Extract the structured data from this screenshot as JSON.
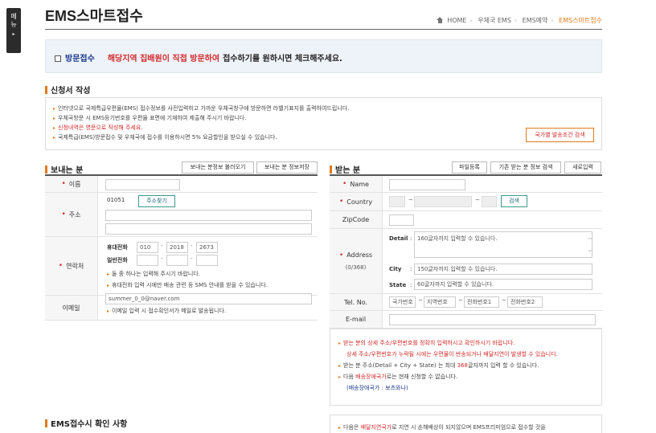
{
  "side_menu": {
    "label_1": "메",
    "label_2": "뉴",
    "arrow": "▸"
  },
  "header": {
    "title": "EMS스마트접수",
    "breadcrumb": [
      "HOME",
      "우체국 EMS",
      "EMS예약",
      "EMS스마트접수"
    ],
    "icons": {
      "home": "home-icon"
    }
  },
  "visit": {
    "label": "방문접수",
    "highlight": "해당지역 집배원이 직접 방문하여",
    "rest": "접수하기를 원하시면 체크해주세요."
  },
  "application": {
    "title": "신청서 작성",
    "notices": [
      "인터넷으로 국제특급우편물(EMS) 접수정보를 사전입력하고 가까운 우체국창구에 방문하면 라벨기표지를 출력하여드립니다.",
      "우체국방문 시 EMS등기번호를 우편물 표면에 기재하여 제출해 주시기 바랍니다.",
      "신청내역은 영문으로 작성해 주세요.",
      "국제특급(EMS)방문접수 및 우체국에 접수를 이용하시면 5% 요금할인을 받으실 수 있습니다."
    ],
    "country_button": "국가별 발송조건 검색"
  },
  "sender": {
    "title": "보내는 분",
    "btn_load": "보내는 분정보 불러오기",
    "btn_save": "보내는 분 정보저장",
    "name_label": "이름",
    "address_label": "주소",
    "zip_value": "01051",
    "zip_search": "주소찾기",
    "contact_label": "연락처",
    "mobile_label": "휴대전화",
    "mobile": [
      "010",
      "2018",
      "2673"
    ],
    "phone_label": "일반전화",
    "contact_notes": [
      "둘 중 하나는 입력해 주시기 바랍니다.",
      "휴대전화 입력 시에만 배송 관련 등 SMS 안내를 받을 수 있습니다."
    ],
    "email_label": "이메일",
    "email_value": "summer_0_0@naver.com",
    "email_note": "이메일 입력 시 접수확인서가 메일로 발송됩니다."
  },
  "receiver": {
    "title": "받는 분",
    "btn_file": "파일등록",
    "btn_search": "기존 받는 분 정보 검색",
    "btn_new": "새로입력",
    "name_label": "Name",
    "country_label": "Country",
    "country_search": "검색",
    "zip_label": "ZipCode",
    "address_label": "Address",
    "address_count": "(0/368)",
    "detail_label": "Detail",
    "detail_placeholder": "160글자까지 입력할 수 있습니다.",
    "city_label": "City",
    "city_placeholder": "150글자까지 입력할 수 있습니다.",
    "state_label": "State",
    "state_placeholder": "60글자까지 입력할 수 있습니다.",
    "tel_label": "Tel. No.",
    "tel_fields": [
      "국가번호",
      "지역번호",
      "전화번호1",
      "전화번호2"
    ],
    "email_label": "E-mail",
    "notice_1": "받는 분의 상세 주소/우편번호를 정확히 입력하시고 확인하시기 바랍니다.",
    "notice_2": "상세 주소/우편번호가 누락될 시에는 우편물이 반송되거나 배달지연이 발생할 수 있습니다.",
    "notice_3_pre": "받는 분 주소(Detail + City + State) 는 최대 ",
    "notice_3_num": "368",
    "notice_3_post": "글자까지 입력 할 수 있습니다.",
    "notice_4_pre": "다음 ",
    "notice_4_red": "배송장애국가",
    "notice_4_post": "로는 현재 신청할 수 없습니다.",
    "notice_5": "(배송장애국가 : 보츠와나)",
    "bottom_pre": "다음은 ",
    "bottom_red": "배달지연국가",
    "bottom_post": "로 지연 시 손해배상이 되지않으며 EMS프리미엄으로 접수할 것을"
  },
  "confirm": {
    "title": "EMS접수시 확인 사항"
  }
}
